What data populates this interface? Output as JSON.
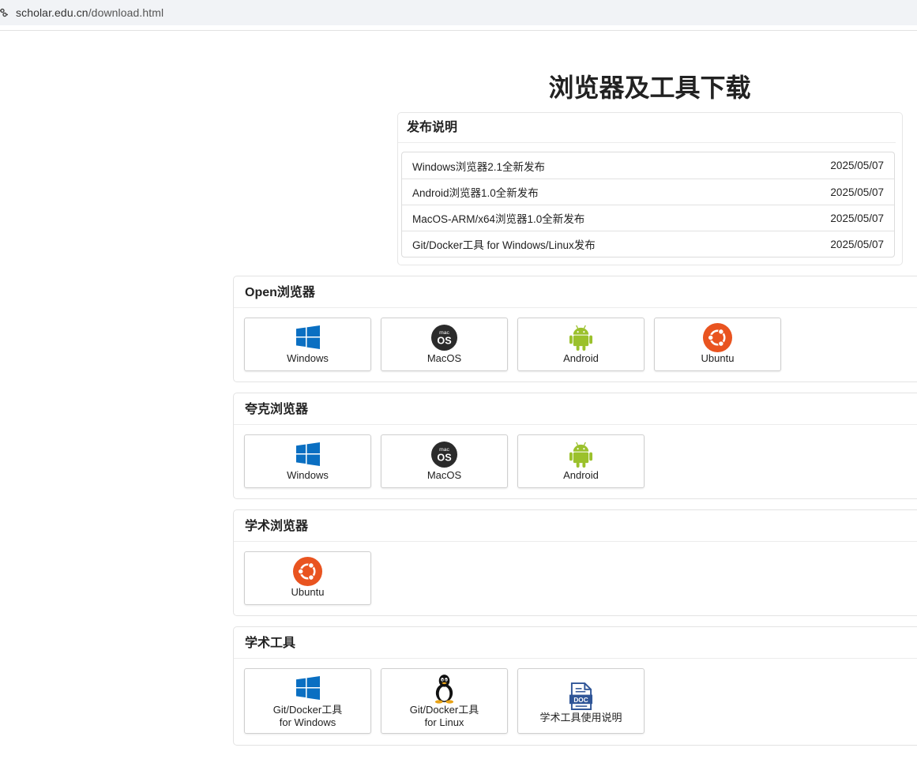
{
  "browser": {
    "url_host": "scholar.edu.cn",
    "url_path": "/download.html"
  },
  "page": {
    "title": "浏览器及工具下载"
  },
  "release": {
    "heading": "发布说明",
    "items": [
      {
        "text": "Windows浏览器2.1全新发布",
        "date": "2025/05/07"
      },
      {
        "text": "Android浏览器1.0全新发布",
        "date": "2025/05/07"
      },
      {
        "text": "MacOS-ARM/x64浏览器1.0全新发布",
        "date": "2025/05/07"
      },
      {
        "text": "Git/Docker工具 for Windows/Linux发布",
        "date": "2025/05/07"
      }
    ]
  },
  "sections": [
    {
      "heading": "Open浏览器",
      "buttons": [
        {
          "label": "Windows",
          "icon": "windows-icon"
        },
        {
          "label": "MacOS",
          "icon": "macos-icon"
        },
        {
          "label": "Android",
          "icon": "android-icon"
        },
        {
          "label": "Ubuntu",
          "icon": "ubuntu-icon"
        }
      ]
    },
    {
      "heading": "夸克浏览器",
      "buttons": [
        {
          "label": "Windows",
          "icon": "windows-icon"
        },
        {
          "label": "MacOS",
          "icon": "macos-icon"
        },
        {
          "label": "Android",
          "icon": "android-icon"
        }
      ]
    },
    {
      "heading": "学术浏览器",
      "buttons": [
        {
          "label": "Ubuntu",
          "icon": "ubuntu-icon"
        }
      ]
    },
    {
      "heading": "学术工具",
      "buttons": [
        {
          "label": "Git/Docker工具",
          "label2": "for Windows",
          "icon": "windows-icon"
        },
        {
          "label": "Git/Docker工具",
          "label2": "for Linux",
          "icon": "linux-tux-icon"
        },
        {
          "label": "学术工具使用说明",
          "icon": "doc-file-icon"
        }
      ]
    }
  ],
  "colors": {
    "windows_blue": "#0a6fc2",
    "android_green": "#9bc12c",
    "ubuntu_orange": "#e95420",
    "macos_dark": "#2b2b2b",
    "doc_blue": "#2f5597"
  }
}
